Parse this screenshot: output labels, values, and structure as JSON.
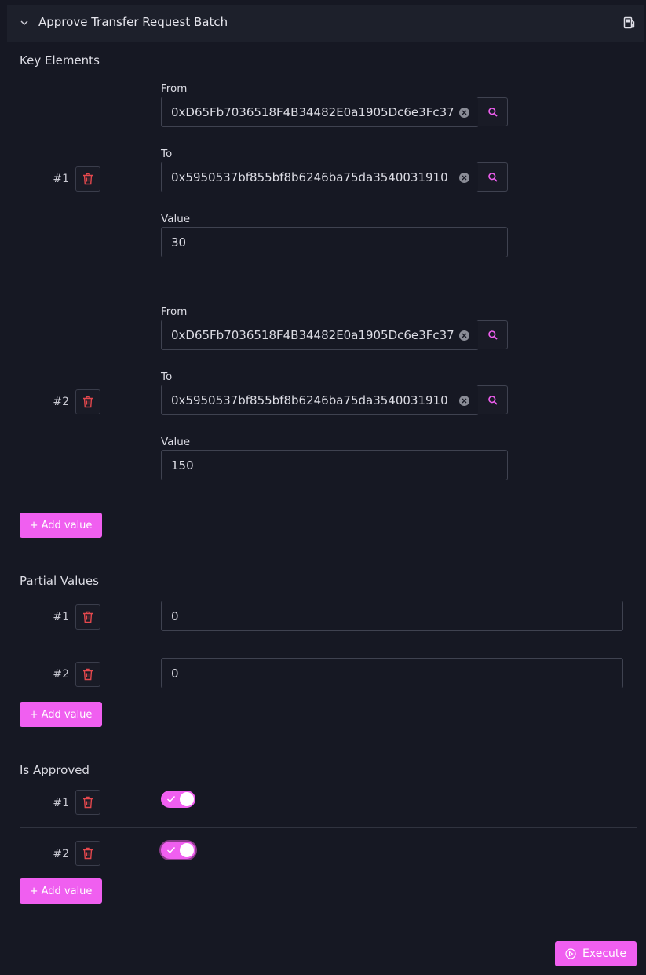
{
  "header": {
    "title": "Approve Transfer Request Batch",
    "collapse_icon": "chevron-down-icon",
    "gas_icon": "gas-pump-icon"
  },
  "key_elements": {
    "title": "Key Elements",
    "rows": [
      {
        "index": "#1",
        "from_label": "From",
        "from": "0xD65Fb7036518F4B34482E0a1905Dc6e3Fc37",
        "to_label": "To",
        "to": "0x5950537bf855bf8b6246ba75da3540031910",
        "value_label": "Value",
        "value": "30"
      },
      {
        "index": "#2",
        "from_label": "From",
        "from": "0xD65Fb7036518F4B34482E0a1905Dc6e3Fc37",
        "to_label": "To",
        "to": "0x5950537bf855bf8b6246ba75da3540031910",
        "value_label": "Value",
        "value": "150"
      }
    ],
    "add_label": "+ Add value"
  },
  "partial_values": {
    "title": "Partial Values",
    "rows": [
      {
        "index": "#1",
        "value": "0"
      },
      {
        "index": "#2",
        "value": "0"
      }
    ],
    "add_label": "+ Add value"
  },
  "is_approved": {
    "title": "Is Approved",
    "rows": [
      {
        "index": "#1",
        "checked": true
      },
      {
        "index": "#2",
        "checked": true
      }
    ],
    "add_label": "+ Add value"
  },
  "execute": {
    "label": "Execute"
  },
  "colors": {
    "accent": "#f05ff0",
    "danger": "#e5484d",
    "background": "#161823"
  }
}
